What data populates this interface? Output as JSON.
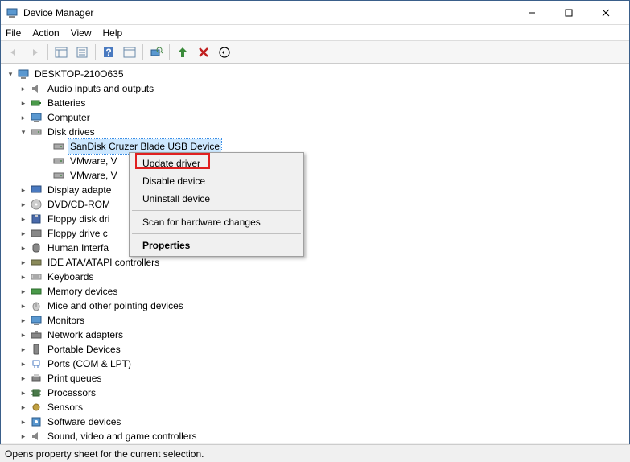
{
  "window": {
    "title": "Device Manager",
    "minimize": "–",
    "maximize": "☐",
    "close": "✕"
  },
  "menubar": [
    "File",
    "Action",
    "View",
    "Help"
  ],
  "tree": {
    "root": "DESKTOP-210O635",
    "disk_drives": "Disk drives",
    "disk_children": [
      "SanDisk Cruzer Blade USB Device",
      "VMware, V",
      "VMware, V"
    ],
    "categories": [
      "Audio inputs and outputs",
      "Batteries",
      "Computer",
      "Display adapte",
      "DVD/CD-ROM",
      "Floppy disk dri",
      "Floppy drive c",
      "Human Interfa",
      "IDE ATA/ATAPI controllers",
      "Keyboards",
      "Memory devices",
      "Mice and other pointing devices",
      "Monitors",
      "Network adapters",
      "Portable Devices",
      "Ports (COM & LPT)",
      "Print queues",
      "Processors",
      "Sensors",
      "Software devices",
      "Sound, video and game controllers"
    ]
  },
  "context_menu": {
    "update": "Update driver",
    "disable": "Disable device",
    "uninstall": "Uninstall device",
    "scan": "Scan for hardware changes",
    "properties": "Properties"
  },
  "statusbar": "Opens property sheet for the current selection."
}
